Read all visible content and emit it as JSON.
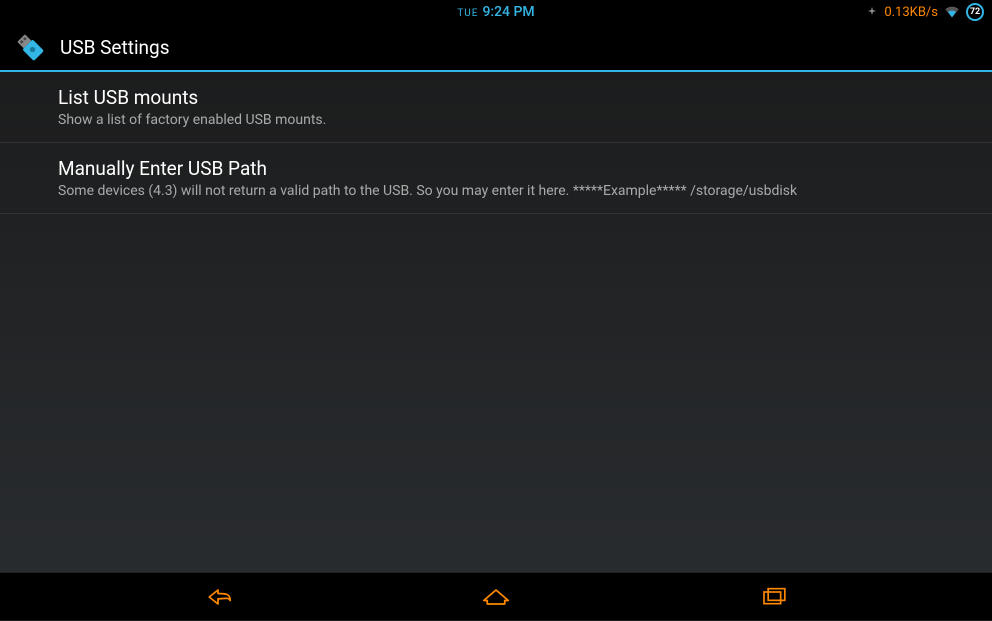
{
  "status_bar": {
    "day": "TUE",
    "time": "9:24 PM",
    "network_speed": "0.13KB/s",
    "battery_percent": "72"
  },
  "action_bar": {
    "title": "USB Settings"
  },
  "settings": {
    "items": [
      {
        "title": "List USB mounts",
        "summary": "Show a list of factory enabled USB mounts."
      },
      {
        "title": "Manually Enter USB Path",
        "summary": "Some devices (4.3) will not return a valid path to the USB. So you may enter it here. *****Example***** /storage/usbdisk"
      }
    ]
  },
  "colors": {
    "accent": "#33b5e5",
    "nav_icon": "#ff8800"
  }
}
